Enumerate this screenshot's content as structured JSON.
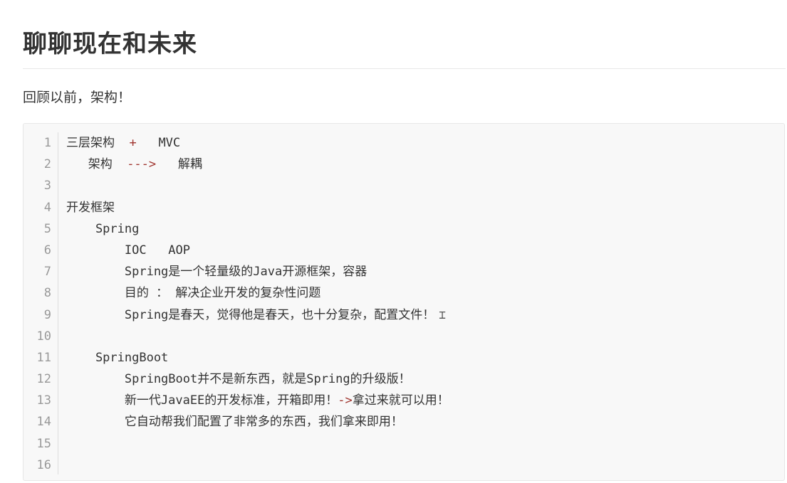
{
  "document": {
    "title": "聊聊现在和未来",
    "intro": "回顾以前，架构！"
  },
  "code": {
    "line_numbers": [
      "1",
      "2",
      "3",
      "4",
      "5",
      "6",
      "7",
      "8",
      "9",
      "10",
      "11",
      "12",
      "13",
      "14",
      "15",
      "16"
    ],
    "lines": {
      "l1": {
        "a": "三层架构  ",
        "op": "+",
        "b": "   MVC"
      },
      "l2": {
        "a": "   架构  ",
        "op": "--->",
        "b": "   解耦"
      },
      "l4": "开发框架",
      "l5": "    Spring",
      "l6": "        IOC   AOP",
      "l7": "        Spring是一个轻量级的Java开源框架，容器",
      "l8": "        目的 ： 解决企业开发的复杂性问题",
      "l9": "        Spring是春天，觉得他是春天，也十分复杂，配置文件！",
      "l11": "    SpringBoot",
      "l12": "        SpringBoot并不是新东西，就是Spring的升级版！",
      "l13": {
        "a": "        新一代JavaEE的开发标准，开箱即用！",
        "op": "->",
        "b": "拿过来就可以用！"
      },
      "l14": "        它自动帮我们配置了非常多的东西，我们拿来即用！"
    }
  },
  "icons": {
    "text_cursor": "text-cursor-icon"
  },
  "colors": {
    "operator": "#a0342e",
    "code_background": "#f8f8f8",
    "line_number": "#999999"
  }
}
